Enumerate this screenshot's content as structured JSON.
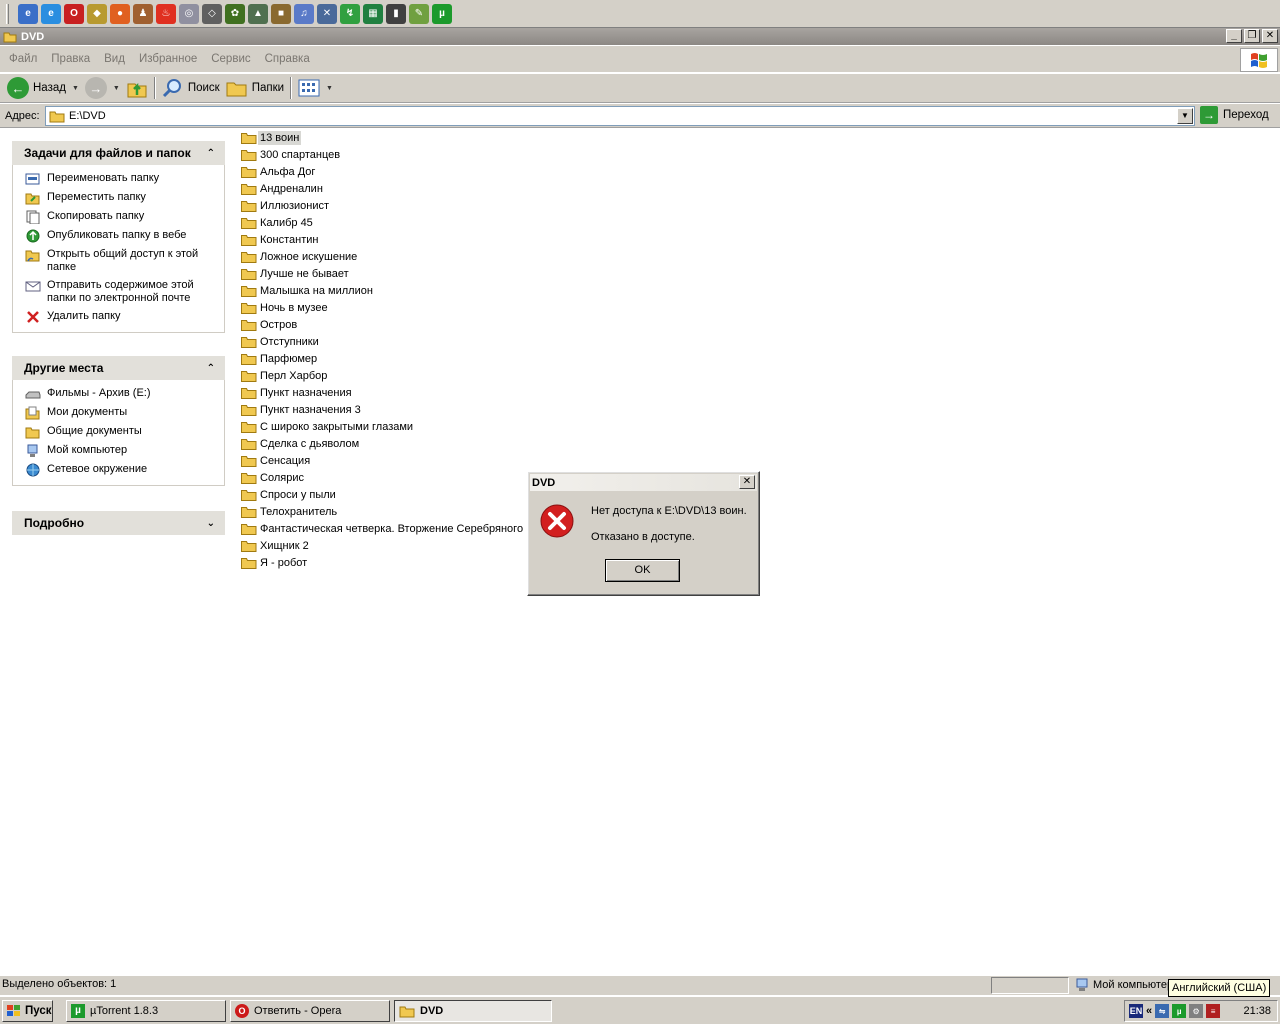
{
  "window": {
    "title": "DVD",
    "controls": [
      "_",
      "❐",
      "✕"
    ]
  },
  "menu": [
    "Файл",
    "Правка",
    "Вид",
    "Избранное",
    "Сервис",
    "Справка"
  ],
  "toolbar": {
    "back_label": "Назад",
    "search_label": "Поиск",
    "folders_label": "Папки"
  },
  "address": {
    "label": "Адрес:",
    "value": "E:\\DVD",
    "go_label": "Переход"
  },
  "tasks_panel": {
    "title": "Задачи для файлов и папок",
    "items": [
      {
        "label": "Переименовать папку",
        "icon": "rename-icon"
      },
      {
        "label": "Переместить папку",
        "icon": "move-icon"
      },
      {
        "label": "Скопировать папку",
        "icon": "copy-icon"
      },
      {
        "label": "Опубликовать папку в вебе",
        "icon": "publish-web-icon"
      },
      {
        "label": "Открыть общий доступ к этой папке",
        "icon": "share-icon"
      },
      {
        "label": "Отправить содержимое этой папки по электронной почте",
        "icon": "email-icon"
      },
      {
        "label": "Удалить папку",
        "icon": "delete-icon"
      }
    ]
  },
  "places_panel": {
    "title": "Другие места",
    "items": [
      {
        "label": "Фильмы - Архив (E:)",
        "icon": "drive-icon"
      },
      {
        "label": "Мои документы",
        "icon": "my-documents-icon"
      },
      {
        "label": "Общие документы",
        "icon": "folder-icon"
      },
      {
        "label": "Мой компьютер",
        "icon": "my-computer-icon"
      },
      {
        "label": "Сетевое окружение",
        "icon": "network-icon"
      }
    ]
  },
  "details_panel": {
    "title": "Подробно"
  },
  "files": [
    "13 воин",
    "300 спартанцев",
    "Альфа Дог",
    "Андреналин",
    "Иллюзионист",
    "Калибр 45",
    "Константин",
    "Ложное искушение",
    "Лучше не бывает",
    "Малышка на миллион",
    "Ночь в музее",
    "Остров",
    "Отступники",
    "Парфюмер",
    "Перл Харбор",
    "Пункт назначения",
    "Пункт назначения 3",
    "С широко закрытыми глазами",
    "Сделка с дьяволом",
    "Сенсация",
    "Солярис",
    "Спроси у пыли",
    "Телохранитель",
    "Фантастическая четверка. Вторжение Серебряного",
    "Хищник 2",
    "Я - робот"
  ],
  "selected_file": "13 воин",
  "dialog": {
    "title": "DVD",
    "message": "Нет доступа к E:\\DVD\\13 воин.",
    "detail": "Отказано в доступе.",
    "ok_label": "OK"
  },
  "statusbar": {
    "selected": "Выделено объектов: 1",
    "location": "Мой компьютер"
  },
  "tooltip": "Английский (США)",
  "taskbar": {
    "start_label": "Пуск",
    "tasks": [
      {
        "label": "µTorrent 1.8.3"
      },
      {
        "label": "Ответить - Opera"
      },
      {
        "label": "DVD"
      }
    ],
    "tray_lang": "EN",
    "clock": "21:38"
  },
  "colors": {
    "error_red": "#d21f1f",
    "folder_yellow": "#f0c850",
    "utorrent_green": "#1c9a2c",
    "opera_red": "#cc1a1a"
  }
}
